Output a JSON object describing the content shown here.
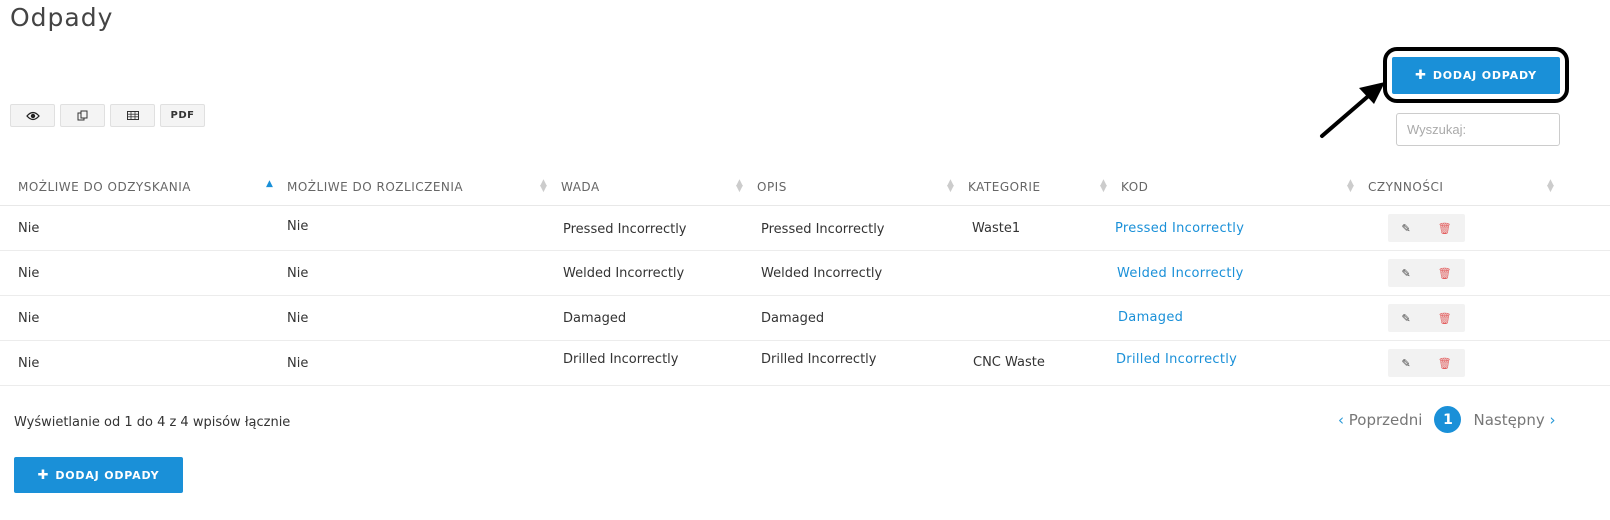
{
  "page": {
    "title": "Odpady"
  },
  "toolbar": {
    "add_label": "DODAJ ODPADY",
    "export_buttons": [
      {
        "icon": "eye-icon",
        "label": ""
      },
      {
        "icon": "copy-icon",
        "label": ""
      },
      {
        "icon": "table-icon",
        "label": ""
      },
      {
        "icon": "",
        "label": "PDF"
      }
    ]
  },
  "search": {
    "placeholder": "Wyszukaj:"
  },
  "table": {
    "headers": [
      "MOŻLIWE DO ODZYSKANIA",
      "MOŻLIWE DO ROZLICZENIA",
      "WADA",
      "OPIS",
      "KATEGORIE",
      "KOD",
      "CZYNNOŚCI"
    ],
    "rows": [
      {
        "odzyskania": "Nie",
        "rozliczenia": "Nie",
        "wada": "Pressed Incorrectly",
        "opis": "Pressed Incorrectly",
        "kategorie": "Waste1",
        "kod": "Pressed Incorrectly"
      },
      {
        "odzyskania": "Nie",
        "rozliczenia": "Nie",
        "wada": "Welded Incorrectly",
        "opis": "Welded Incorrectly",
        "kategorie": "",
        "kod": "Welded Incorrectly"
      },
      {
        "odzyskania": "Nie",
        "rozliczenia": "Nie",
        "wada": "Damaged",
        "opis": "Damaged",
        "kategorie": "",
        "kod": "Damaged"
      },
      {
        "odzyskania": "Nie",
        "rozliczenia": "Nie",
        "wada": "Drilled Incorrectly",
        "opis": "Drilled Incorrectly",
        "kategorie": "CNC Waste",
        "kod": "Drilled Incorrectly"
      }
    ]
  },
  "footer": {
    "info": "Wyświetlanie od 1 do 4 z 4 wpisów łącznie",
    "prev_label": "Poprzedni",
    "next_label": "Następny",
    "current_page": "1"
  },
  "colors": {
    "accent": "#1a90d8",
    "delete": "#e25c5c"
  }
}
